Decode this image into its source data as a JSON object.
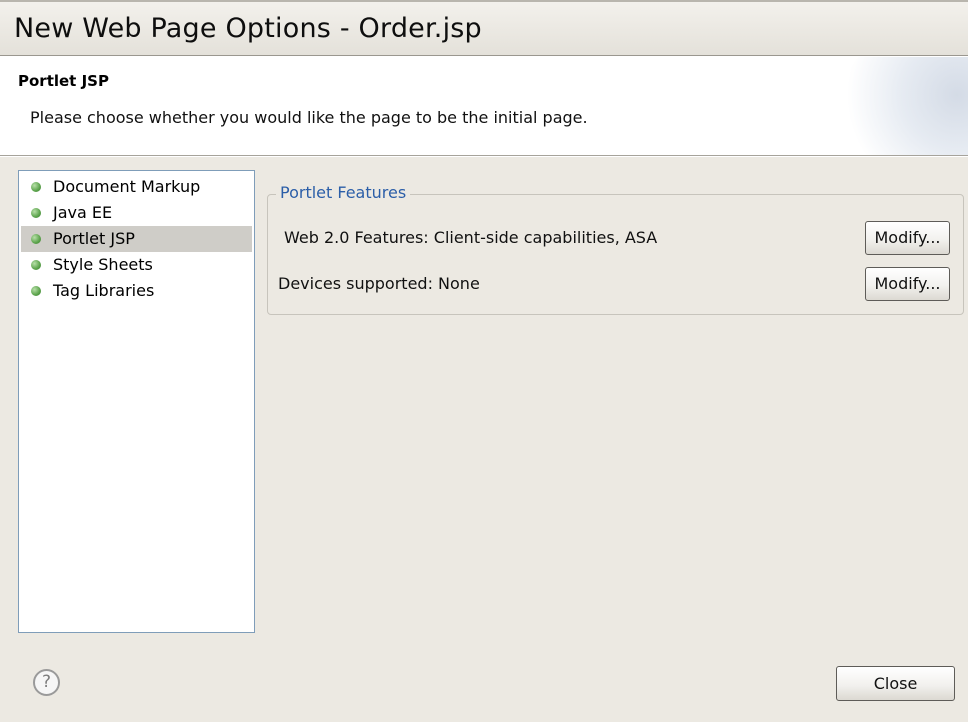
{
  "window": {
    "title": "New Web Page Options - Order.jsp"
  },
  "header": {
    "heading": "Portlet JSP",
    "description": "Please choose whether you would like the page to be the initial page."
  },
  "nav": {
    "items": [
      {
        "label": "Document Markup",
        "selected": false
      },
      {
        "label": "Java EE",
        "selected": false
      },
      {
        "label": "Portlet JSP",
        "selected": true
      },
      {
        "label": "Style Sheets",
        "selected": false
      },
      {
        "label": "Tag Libraries",
        "selected": false
      }
    ]
  },
  "features": {
    "legend": "Portlet Features",
    "web20_text": "Web 2.0 Features: Client-side capabilities, ASA",
    "devices_text": "Devices supported:  None",
    "modify_label": "Modify..."
  },
  "footer": {
    "help_glyph": "?",
    "close_label": "Close"
  },
  "colors": {
    "legend_text": "#2b5ea8",
    "status_dot": "#5aa24a",
    "dialog_background": "#ece9e2"
  }
}
